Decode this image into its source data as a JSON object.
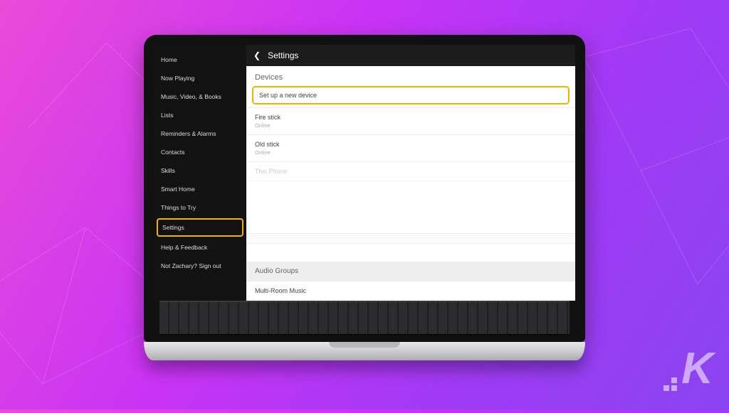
{
  "sidebar": {
    "items": [
      {
        "label": "Home"
      },
      {
        "label": "Now Playing"
      },
      {
        "label": "Music, Video, & Books"
      },
      {
        "label": "Lists"
      },
      {
        "label": "Reminders & Alarms"
      },
      {
        "label": "Contacts"
      },
      {
        "label": "Skills"
      },
      {
        "label": "Smart Home"
      },
      {
        "label": "Things to Try"
      },
      {
        "label": "Settings"
      },
      {
        "label": "Help & Feedback"
      },
      {
        "label": "Not Zachary? Sign out"
      }
    ],
    "selected_index": 9
  },
  "header": {
    "title": "Settings"
  },
  "devices": {
    "section_label": "Devices",
    "setup_label": "Set up a new device",
    "list": [
      {
        "name": "Fire stick",
        "status": "Online"
      },
      {
        "name": "Old stick",
        "status": "Online"
      },
      {
        "name": "This Phone",
        "status": ""
      }
    ]
  },
  "audio_groups": {
    "section_label": "Audio Groups",
    "items": [
      {
        "name": "Multi-Room Music"
      }
    ]
  },
  "branding": {
    "watermark_letter": "K"
  }
}
